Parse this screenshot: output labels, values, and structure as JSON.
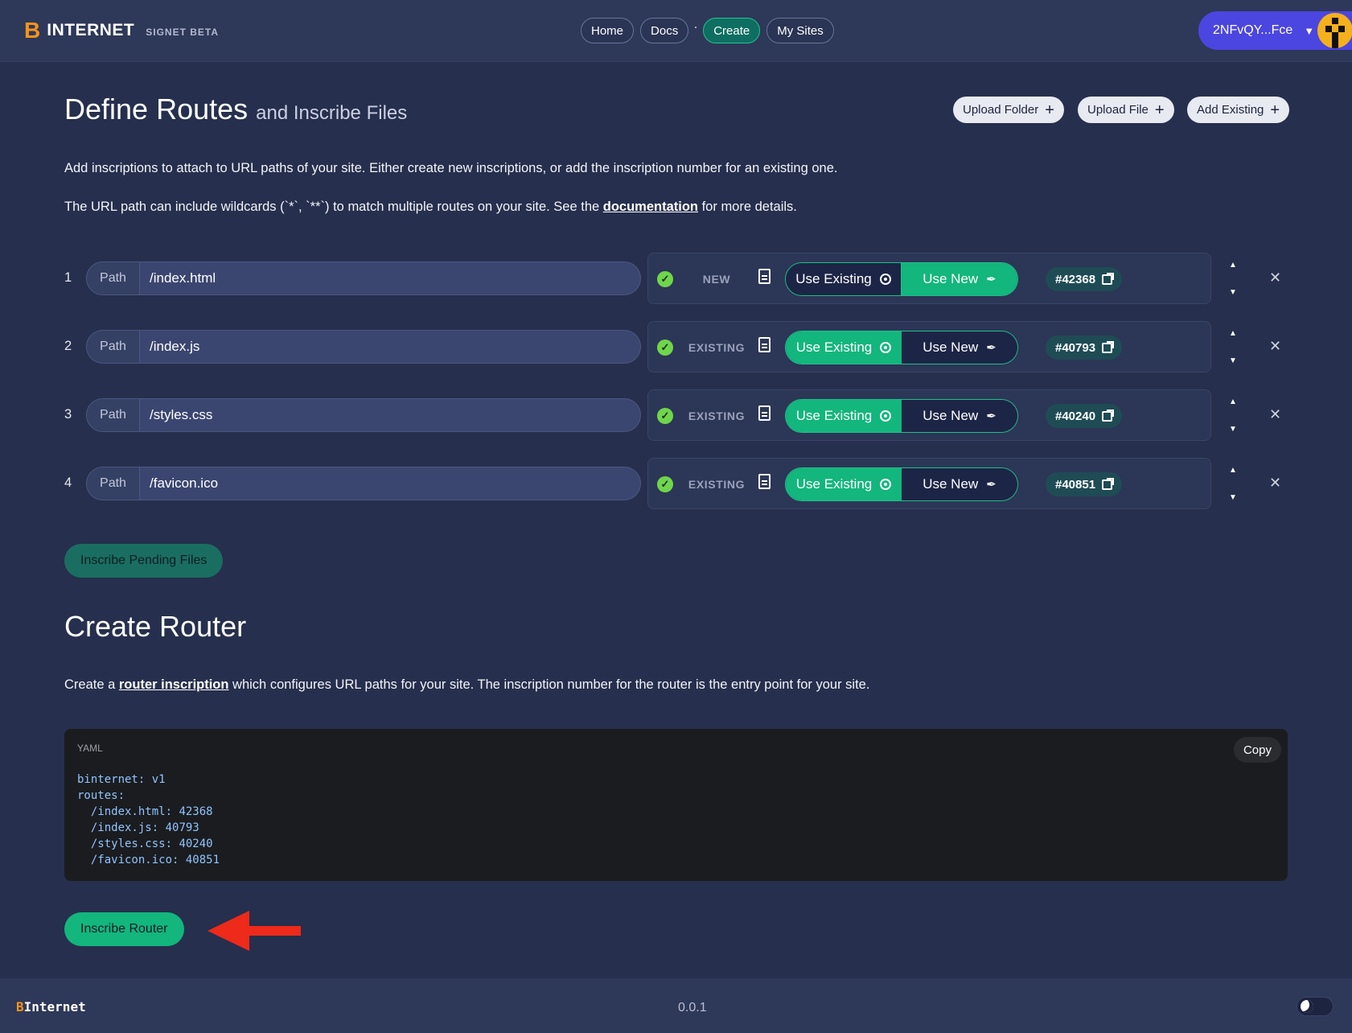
{
  "header": {
    "logo_b": "B",
    "logo_text": "INTERNET",
    "logo_sub": "SIGNET  BETA",
    "nav": [
      "Home",
      "Docs",
      "Create",
      "My Sites"
    ],
    "active_nav": "Create",
    "wallet": "2NFvQY...Fce"
  },
  "section1": {
    "title": "Define Routes",
    "subtitle": "and Inscribe Files",
    "buttons": {
      "upload_folder": "Upload Folder",
      "upload_file": "Upload File",
      "add_existing": "Add Existing"
    },
    "p1": "Add inscriptions to attach to URL paths of your site. Either create new inscriptions, or add the inscription number for an existing one.",
    "p2_pre": "The URL path can include wildcards (`*`, `**`) to match multiple routes on your site. See the ",
    "p2_link": "documentation",
    "p2_post": " for more details."
  },
  "routes": [
    {
      "index": "1",
      "label": "Path",
      "path": "/index.html",
      "status": "NEW",
      "mode": "new",
      "existing_label": "Use Existing",
      "new_label": "Use New",
      "inscription": "#42368"
    },
    {
      "index": "2",
      "label": "Path",
      "path": "/index.js",
      "status": "EXISTING",
      "mode": "existing",
      "existing_label": "Use Existing",
      "new_label": "Use New",
      "inscription": "#40793"
    },
    {
      "index": "3",
      "label": "Path",
      "path": "/styles.css",
      "status": "EXISTING",
      "mode": "existing",
      "existing_label": "Use Existing",
      "new_label": "Use New",
      "inscription": "#40240"
    },
    {
      "index": "4",
      "label": "Path",
      "path": "/favicon.ico",
      "status": "EXISTING",
      "mode": "existing",
      "existing_label": "Use Existing",
      "new_label": "Use New",
      "inscription": "#40851"
    }
  ],
  "pending_button": "Inscribe Pending Files",
  "section2": {
    "title": "Create Router",
    "p_pre": "Create a ",
    "p_link": "router inscription",
    "p_post": " which configures URL paths for your site. The inscription number for the router is the entry point for your site."
  },
  "code": {
    "lang": "YAML",
    "copy": "Copy",
    "lines": [
      {
        "key": "binternet:",
        "val": " v1"
      },
      {
        "key": "routes:",
        "val": ""
      },
      {
        "key": "  /index.html:",
        "val": " 42368"
      },
      {
        "key": "  /index.js:",
        "val": " 40793"
      },
      {
        "key": "  /styles.css:",
        "val": " 40240"
      },
      {
        "key": "  /favicon.ico:",
        "val": " 40851"
      }
    ]
  },
  "router_button": "Inscribe Router",
  "footer": {
    "logo_b": "B",
    "logo_text": "Internet",
    "version": "0.0.1"
  },
  "colors": {
    "bg": "#262f4d",
    "accent": "#13b67d",
    "brand": "#f7931a",
    "wallet": "#4b46e0"
  }
}
